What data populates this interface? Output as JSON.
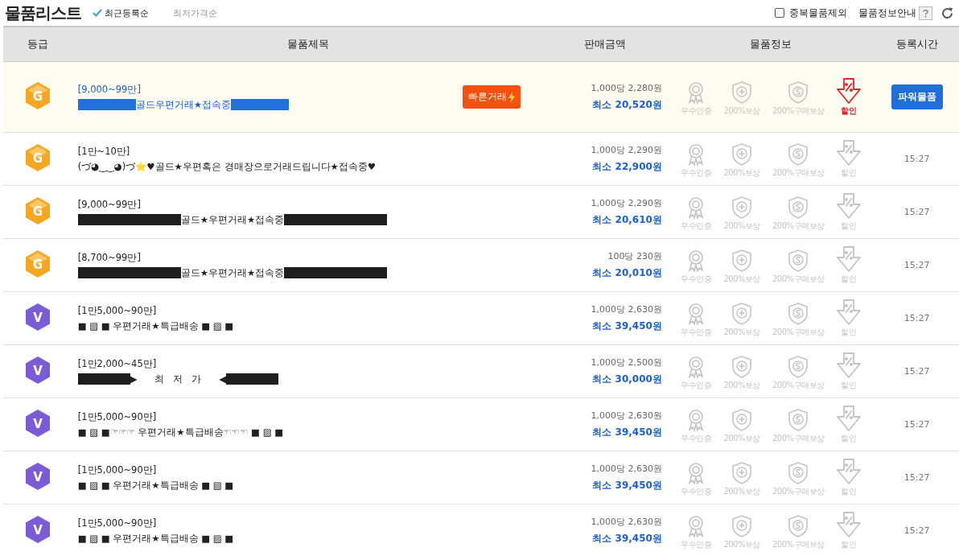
{
  "header": {
    "title": "물품리스트",
    "sorts": [
      {
        "label": "최근등록순",
        "selected": true
      },
      {
        "label": "최저가격순",
        "selected": false
      }
    ],
    "exclude_duplicates": {
      "label": "중복물품제외",
      "checked": false
    },
    "info_guide": "물품정보안내"
  },
  "table": {
    "columns": [
      "등급",
      "물품제목",
      "판매금액",
      "물품정보",
      "등록시간"
    ],
    "rows": [
      {
        "highlighted": true,
        "grade": {
          "kind": "gold",
          "letter": "G"
        },
        "range": "[9,000~99만]",
        "title": [
          {
            "kind": "bar-medium"
          },
          {
            "kind": "text",
            "text": "골드우편거래★접속중"
          },
          {
            "kind": "bar-medium"
          }
        ],
        "quick_button": "빠른거래",
        "unit_price": "1,000당 2,280원",
        "min_price": "최소 20,520원",
        "badges": [
          {
            "kind": "medal",
            "label": "우수인증",
            "active": false
          },
          {
            "kind": "shield-plus",
            "label": "200%보상",
            "active": false
          },
          {
            "kind": "shield-s",
            "label": "200%구매보상",
            "active": false
          },
          {
            "kind": "discount",
            "label": "할인",
            "active": true
          }
        ],
        "power_button": "파워물품"
      },
      {
        "highlighted": false,
        "grade": {
          "kind": "gold",
          "letter": "G"
        },
        "range": "[1만~10만]",
        "title": [
          {
            "kind": "text",
            "text": "(づ◕‿‿◕)づ⭐♥골드★우편혹은 경매장으로거래드립니다★접속중♥"
          }
        ],
        "unit_price": "1,000당 2,290원",
        "min_price": "최소 22,900원",
        "badges": [
          {
            "kind": "medal",
            "label": "우수인증",
            "active": false
          },
          {
            "kind": "shield-plus",
            "label": "200%보상",
            "active": false
          },
          {
            "kind": "shield-s",
            "label": "200%구매보상",
            "active": false
          },
          {
            "kind": "discount",
            "label": "할인",
            "active": false
          }
        ],
        "time": "15:27"
      },
      {
        "highlighted": false,
        "grade": {
          "kind": "gold",
          "letter": "G"
        },
        "range": "[9,000~99만]",
        "title": [
          {
            "kind": "bar-long"
          },
          {
            "kind": "text",
            "text": "골드★우편거래★접속중"
          },
          {
            "kind": "bar-long"
          }
        ],
        "unit_price": "1,000당 2,290원",
        "min_price": "최소 20,610원",
        "badges": [
          {
            "kind": "medal",
            "label": "우수인증",
            "active": false
          },
          {
            "kind": "shield-plus",
            "label": "200%보상",
            "active": false
          },
          {
            "kind": "shield-s",
            "label": "200%구매보상",
            "active": false
          },
          {
            "kind": "discount",
            "label": "할인",
            "active": false
          }
        ],
        "time": "15:27"
      },
      {
        "highlighted": false,
        "grade": {
          "kind": "gold",
          "letter": "G"
        },
        "range": "[8,700~99만]",
        "title": [
          {
            "kind": "bar-long"
          },
          {
            "kind": "text",
            "text": "골드★우편거래★접속중"
          },
          {
            "kind": "bar-long"
          }
        ],
        "unit_price": "100당 230원",
        "min_price": "최소 20,010원",
        "badges": [
          {
            "kind": "medal",
            "label": "우수인증",
            "active": false
          },
          {
            "kind": "shield-plus",
            "label": "200%보상",
            "active": false
          },
          {
            "kind": "shield-s",
            "label": "200%구매보상",
            "active": false
          },
          {
            "kind": "discount",
            "label": "할인",
            "active": false
          }
        ],
        "time": "15:27"
      },
      {
        "highlighted": false,
        "grade": {
          "kind": "vip",
          "letter": "V"
        },
        "range": "[1만5,000~90만]",
        "title": [
          {
            "kind": "text",
            "text": "■ ▨ ■ 우편거래★특급배송 ■ ▨ ■"
          }
        ],
        "unit_price": "1,000당 2,630원",
        "min_price": "최소 39,450원",
        "badges": [
          {
            "kind": "medal",
            "label": "우수인증",
            "active": false
          },
          {
            "kind": "shield-plus",
            "label": "200%보상",
            "active": false
          },
          {
            "kind": "shield-s",
            "label": "200%구매보상",
            "active": false
          },
          {
            "kind": "discount",
            "label": "할인",
            "active": false
          }
        ],
        "time": "15:27"
      },
      {
        "highlighted": false,
        "grade": {
          "kind": "vip",
          "letter": "V"
        },
        "range": "[1만2,000~45만]",
        "title": [
          {
            "kind": "bar-short"
          },
          {
            "kind": "text",
            "text": "▶      최   저   가      ◀"
          },
          {
            "kind": "bar-short"
          }
        ],
        "unit_price": "1,000당 2,500원",
        "min_price": "최소 30,000원",
        "badges": [
          {
            "kind": "medal",
            "label": "우수인증",
            "active": false
          },
          {
            "kind": "shield-plus",
            "label": "200%보상",
            "active": false
          },
          {
            "kind": "shield-s",
            "label": "200%구매보상",
            "active": false
          },
          {
            "kind": "discount",
            "label": "할인",
            "active": false
          }
        ],
        "time": "15:27"
      },
      {
        "highlighted": false,
        "grade": {
          "kind": "vip",
          "letter": "V"
        },
        "range": "[1만5,000~90만]",
        "title": [
          {
            "kind": "text",
            "text": "■ ▨ ■☞☞☞ 우편거래★특급배송☜☜☜ ■ ▨ ■"
          }
        ],
        "unit_price": "1,000당 2,630원",
        "min_price": "최소 39,450원",
        "badges": [
          {
            "kind": "medal",
            "label": "우수인증",
            "active": false
          },
          {
            "kind": "shield-plus",
            "label": "200%보상",
            "active": false
          },
          {
            "kind": "shield-s",
            "label": "200%구매보상",
            "active": false
          },
          {
            "kind": "discount",
            "label": "할인",
            "active": false
          }
        ],
        "time": "15:27"
      },
      {
        "highlighted": false,
        "grade": {
          "kind": "vip",
          "letter": "V"
        },
        "range": "[1만5,000~90만]",
        "title": [
          {
            "kind": "text",
            "text": "■ ▨ ■ 우편거래★특급배송 ■ ▨ ■"
          }
        ],
        "unit_price": "1,000당 2,630원",
        "min_price": "최소 39,450원",
        "badges": [
          {
            "kind": "medal",
            "label": "우수인증",
            "active": false
          },
          {
            "kind": "shield-plus",
            "label": "200%보상",
            "active": false
          },
          {
            "kind": "shield-s",
            "label": "200%구매보상",
            "active": false
          },
          {
            "kind": "discount",
            "label": "할인",
            "active": false
          }
        ],
        "time": "15:27"
      },
      {
        "highlighted": false,
        "grade": {
          "kind": "vip",
          "letter": "V"
        },
        "range": "[1만5,000~90만]",
        "title": [
          {
            "kind": "text",
            "text": "■ ▨ ■ 우편거래★특급배송 ■ ▨ ■"
          }
        ],
        "unit_price": "1,000당 2,630원",
        "min_price": "최소 39,450원",
        "badges": [
          {
            "kind": "medal",
            "label": "우수인증",
            "active": false
          },
          {
            "kind": "shield-plus",
            "label": "200%보상",
            "active": false
          },
          {
            "kind": "shield-s",
            "label": "200%구매보상",
            "active": false
          },
          {
            "kind": "discount",
            "label": "할인",
            "active": false
          }
        ],
        "time": "15:27"
      }
    ]
  }
}
